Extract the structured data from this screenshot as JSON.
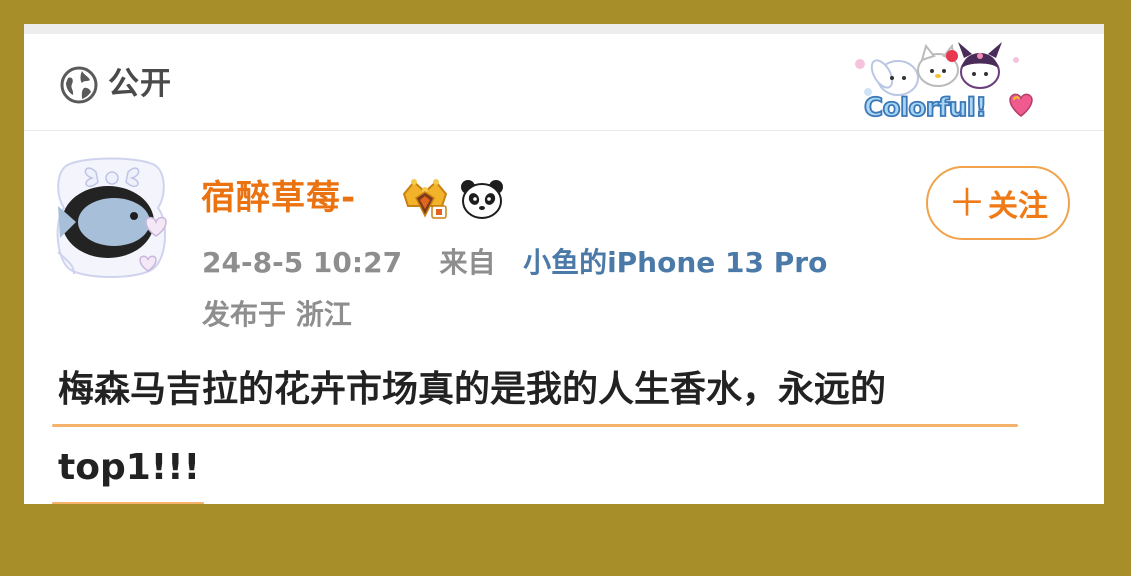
{
  "visibility": {
    "icon": "globe-icon",
    "label": "公开"
  },
  "sticker": {
    "text": "Colorful!",
    "icon": "cute-characters-sticker"
  },
  "author": {
    "avatar": "fish-avatar",
    "name": "宿醉草莓-",
    "badges": [
      "crown-vip-badge",
      "panda-badge"
    ],
    "follow_label": "关注",
    "follow_icon": "plus-icon"
  },
  "post": {
    "date": "24-8-5 10:27",
    "from_label": "来自",
    "device": "小鱼的iPhone 13 Pro",
    "location": "发布于 浙江",
    "lines": [
      "梅森马吉拉的花卉市场真的是我的人生香水，永远的",
      "top1!!!"
    ]
  },
  "colors": {
    "background": "#a88e28",
    "username": "#eb7210",
    "source_link": "#4b79a8",
    "follow_border": "#f0a34a",
    "underline": "#f4b26a"
  }
}
